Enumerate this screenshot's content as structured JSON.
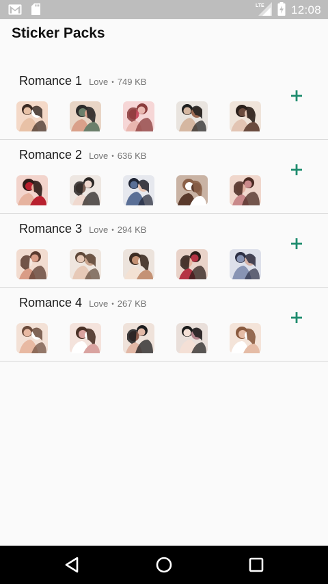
{
  "status_bar": {
    "time": "12:08",
    "network": "LTE",
    "icons": [
      "gmail-icon",
      "sd-card-icon",
      "lte-signal-icon",
      "battery-charging-icon"
    ]
  },
  "app_bar": {
    "title": "Sticker Packs"
  },
  "packs": [
    {
      "name": "Romance 1",
      "publisher": "Love",
      "size": "749 KB",
      "stickers": [
        {
          "bg": "#f4d9c8",
          "a": "#3b2a22",
          "b": "#e8c1a6",
          "c": "#ffffff"
        },
        {
          "bg": "#e8d5c6",
          "a": "#2b2b2b",
          "b": "#6b7f6b",
          "c": "#d9a08a"
        },
        {
          "bg": "#f6d6d6",
          "a": "#8a3b3b",
          "b": "#e9b7b0",
          "c": "#c94f63"
        },
        {
          "bg": "#e9e4df",
          "a": "#1e1e1e",
          "b": "#d5b7a1",
          "c": "#9c6a52"
        },
        {
          "bg": "#efe4da",
          "a": "#2a1f1a",
          "b": "#6a4b3e",
          "c": "#e2c4b3"
        }
      ]
    },
    {
      "name": "Romance 2",
      "publisher": "Love",
      "size": "636 KB",
      "stickers": [
        {
          "bg": "#f2d4cc",
          "a": "#2e1c18",
          "b": "#b8202e",
          "c": "#e6b39f"
        },
        {
          "bg": "#eee7e2",
          "a": "#2a2624",
          "b": "#f0d9cf",
          "c": "#7a5e52"
        },
        {
          "bg": "#e6e8ee",
          "a": "#1f2433",
          "b": "#5a6f96",
          "c": "#e9c6b4"
        },
        {
          "bg": "#c9b3a4",
          "a": "#8a6048",
          "b": "#ffffff",
          "c": "#5a3a2c"
        },
        {
          "bg": "#f0d7cc",
          "a": "#4a2a22",
          "b": "#c9898a",
          "c": "#e3b3a2"
        }
      ]
    },
    {
      "name": "Romance 3",
      "publisher": "Love",
      "size": "294 KB",
      "stickers": [
        {
          "bg": "#f2dcd0",
          "a": "#5a3a2e",
          "b": "#d99c86",
          "c": "#f5e6de"
        },
        {
          "bg": "#efe6df",
          "a": "#5e4738",
          "b": "#e7c9b7",
          "c": "#caa58e"
        },
        {
          "bg": "#ece3dc",
          "a": "#3d2d24",
          "b": "#c49275",
          "c": "#f3e1d3"
        },
        {
          "bg": "#e9d3c9",
          "a": "#2b1d19",
          "b": "#b53344",
          "c": "#e6b6a2"
        },
        {
          "bg": "#dde0ea",
          "a": "#2c2f44",
          "b": "#8894b4",
          "c": "#d6b3a7"
        }
      ]
    },
    {
      "name": "Romance 4",
      "publisher": "Love",
      "size": "267 KB",
      "stickers": [
        {
          "bg": "#f3e1d6",
          "a": "#6a4a3a",
          "b": "#e8b9a2",
          "c": "#ffffff"
        },
        {
          "bg": "#f4e3dc",
          "a": "#4a3126",
          "b": "#d9a3a0",
          "c": "#ffffff"
        },
        {
          "bg": "#efe2da",
          "a": "#1d1d1f",
          "b": "#e2b8a6",
          "c": "#8b5a4a"
        },
        {
          "bg": "#e9dfda",
          "a": "#1a1a1a",
          "b": "#f4e0d6",
          "c": "#b3858d"
        },
        {
          "bg": "#f4e4d9",
          "a": "#8a5a3e",
          "b": "#e5bca6",
          "c": "#ffffff"
        }
      ]
    }
  ],
  "accent_color": "#1e8c6e",
  "nav_bar": {
    "buttons": [
      "back-icon",
      "home-icon",
      "recents-icon"
    ]
  }
}
